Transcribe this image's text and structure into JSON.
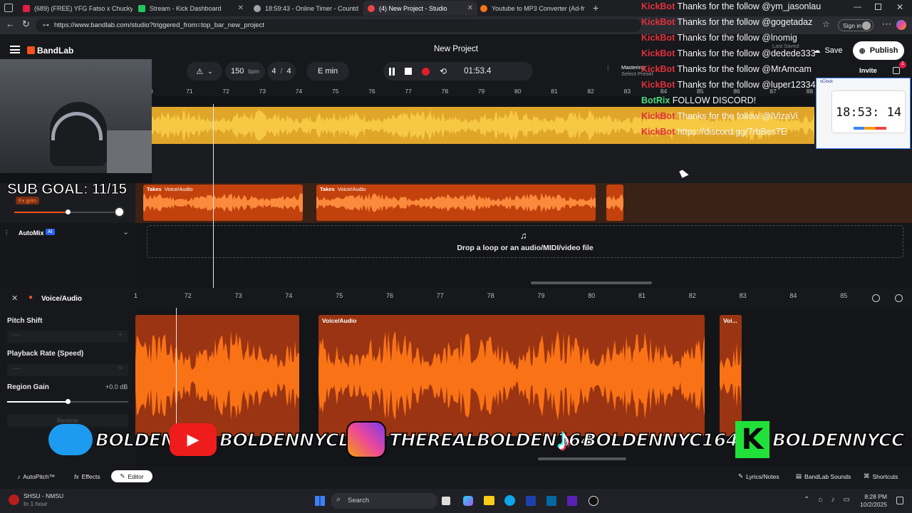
{
  "browser": {
    "tabs": [
      {
        "label": "(689) (FREE) YFG Fatso x Chucky",
        "color": "#e11d48"
      },
      {
        "label": "Stream - Kick Dashboard",
        "color": "#22c55e"
      },
      {
        "label": "18:59:43 - Online Timer - Countd",
        "color": "#9ca3af"
      },
      {
        "label": "(4) New Project - Studio",
        "color": "#ef4444"
      },
      {
        "label": "Youtube to MP3 Converter (Ad-fr",
        "color": "#f97316"
      }
    ],
    "url": "https://www.bandlab.com/studio?triggered_from=top_bar_new_project",
    "signin": "Sign in"
  },
  "app": {
    "logo": "BandLab",
    "title": "New Project",
    "tempo": "150",
    "bpm_unit": "bpm",
    "sig_num": "4",
    "sig_den": "4",
    "key": "E min",
    "time": "01:53.4",
    "mastering": "Mastering",
    "select_preset": "Select Preset",
    "last_saved": "Last Saved",
    "save": "Save",
    "publish": "Publish",
    "invite": "Invite",
    "notif_count": "1"
  },
  "ruler": [
    "0",
    "71",
    "72",
    "73",
    "74",
    "75",
    "76",
    "77",
    "78",
    "79",
    "80",
    "81",
    "82",
    "83",
    "84",
    "85",
    "86",
    "87",
    "88"
  ],
  "track2": {
    "fx_label": "Fx grim",
    "clips": [
      {
        "takes": "Takes",
        "name": "Voice/Audio"
      },
      {
        "takes": "Takes",
        "name": "Voice/Audio"
      }
    ]
  },
  "automix": {
    "label": "AutoMix",
    "badge": "AI"
  },
  "drop_text": "Drop a loop or an audio/MIDI/video file",
  "editor": {
    "title": "Voice/Audio",
    "ruler": [
      "1",
      "72",
      "73",
      "74",
      "75",
      "76",
      "77",
      "78",
      "79",
      "80",
      "81",
      "82",
      "83",
      "84",
      "85"
    ],
    "pitch_shift": "Pitch Shift",
    "playback_rate": "Playback Rate (Speed)",
    "region_gain": "Region Gain",
    "region_gain_value": "+0.0 dB",
    "reverse": "Reverse",
    "clips": [
      "Voice/Audio",
      "Voi..."
    ]
  },
  "footer": {
    "autopitch": "AutoPitch™",
    "effects": "Effects",
    "editor": "Editor",
    "lyrics": "Lyrics/Notes",
    "sounds": "BandLab Sounds",
    "shortcuts": "Shortcuts"
  },
  "taskbar": {
    "game": "SHSU - NMSU",
    "game_sub": "In 1 hour",
    "search": "Search",
    "time": "8:28 PM",
    "date": "10/2/2025"
  },
  "chat": [
    {
      "name": "KickBot",
      "msg": "Thanks for the follow @ym_jasonlau"
    },
    {
      "name": "KickBot",
      "msg": "Thanks for the follow @gogetadaz"
    },
    {
      "name": "KickBot",
      "msg": "Thanks for the follow @lnomig"
    },
    {
      "name": "KickBot",
      "msg": "Thanks for the follow @dedede333"
    },
    {
      "name": "KickBot",
      "msg": "Thanks for the follow @MrAmcam"
    },
    {
      "name": "KickBot",
      "msg": "Thanks for the follow @luper12334"
    },
    {
      "name": "BotRix",
      "msg": "FOLLOW DISCORD!"
    },
    {
      "name": "KickBot",
      "msg": "Thanks for the follow @lVizaVi"
    },
    {
      "name": "KickBot",
      "msg": "https://discord.gg/7rbBes7E"
    }
  ],
  "overlay": {
    "sub_goal": "SUB GOAL: 11/15",
    "vclock_title": "vClock",
    "vclock_time": "18:53: 14",
    "socials": [
      "BOLDENNYC",
      "BOLDENNYCLIVE",
      "THEREALBOLDEN164",
      "BOLDENNYC164",
      "BOLDENNYCC"
    ]
  },
  "colors": {
    "accent": "#f4511e",
    "track_yellow": "#e0a62a",
    "track_orange": "#ea580c",
    "chat_name": "#e1303b"
  }
}
